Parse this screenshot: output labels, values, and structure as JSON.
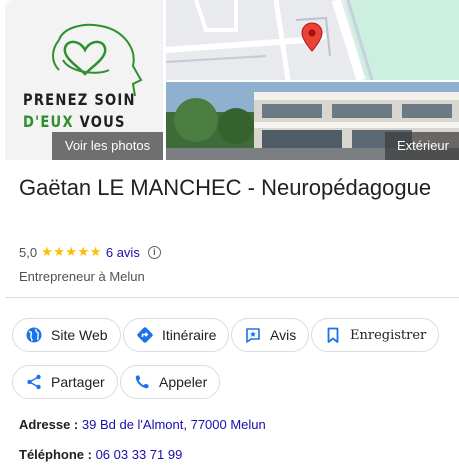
{
  "photos": {
    "logo_line1": "PRENEZ SOIN",
    "logo_line2a": "D'EUX",
    "logo_line2b": "VOUS",
    "see_photos_label": "Voir les photos",
    "exterior_label": "Extérieur"
  },
  "business": {
    "name": "Gaëtan LE MANCHEC - Neuropédagogue",
    "rating": "5,0",
    "stars": "★★★★★",
    "reviews": "6 avis",
    "category": "Entrepreneur à Melun"
  },
  "actions": {
    "website": "Site Web",
    "directions": "Itinéraire",
    "reviews": "Avis",
    "save": "Enregistrer",
    "share": "Partager",
    "call": "Appeler"
  },
  "details": {
    "address_label": "Adresse :",
    "address_value": "39 Bd de l'Almont, 77000 Melun",
    "phone_label": "Téléphone :",
    "phone_value": "06 03 33 71 99"
  },
  "colors": {
    "accent_blue": "#1a73e8",
    "link": "#1a0dab",
    "star": "#fbbc04",
    "logo_green": "#2f8f2f",
    "map_pin": "#ea4335"
  }
}
